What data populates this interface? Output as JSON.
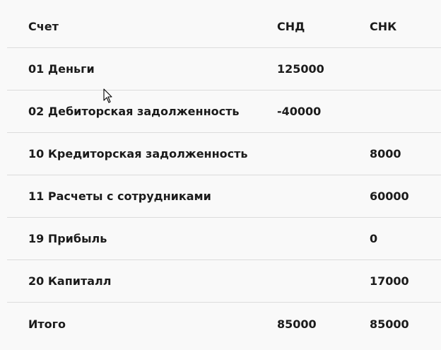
{
  "table": {
    "headers": [
      "Счет",
      "СНД",
      "СНК"
    ],
    "rows": [
      {
        "account": "01 Деньги",
        "debit": "125000",
        "credit": ""
      },
      {
        "account": "02 Дебиторская задолженность",
        "debit": "-40000",
        "credit": ""
      },
      {
        "account": "10 Кредиторская задолженность",
        "debit": "",
        "credit": "8000"
      },
      {
        "account": "11 Расчеты с сотрудниками",
        "debit": "",
        "credit": "60000"
      },
      {
        "account": "19 Прибыль",
        "debit": "",
        "credit": "0"
      },
      {
        "account": "20 Капиталл",
        "debit": "",
        "credit": "17000"
      }
    ],
    "total": {
      "label": "Итого",
      "debit": "85000",
      "credit": "85000"
    }
  }
}
